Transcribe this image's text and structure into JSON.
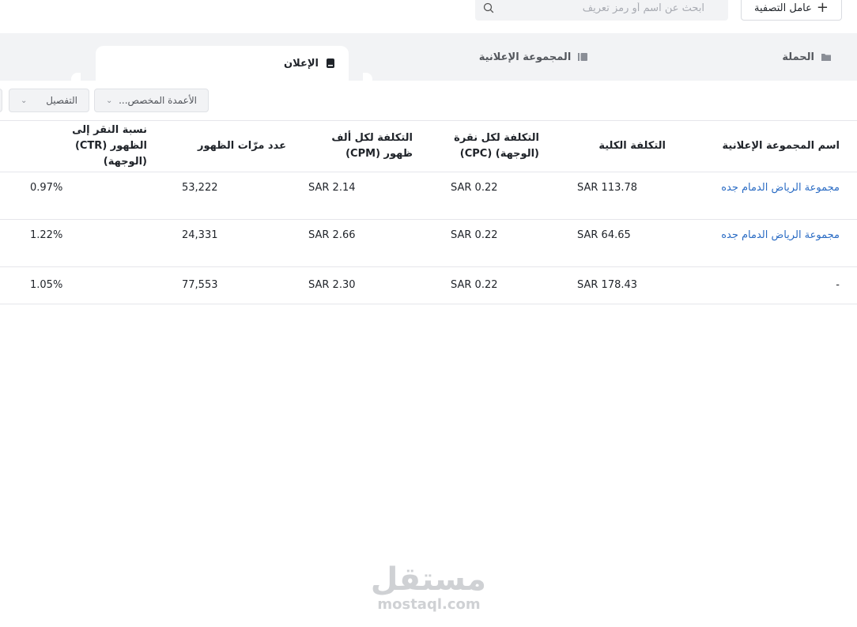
{
  "toolbar": {
    "filter_label": "عامل التصفية",
    "search_placeholder": "ابحث عن اسم أو رمز تعريف"
  },
  "tabs": [
    {
      "label": "الحملة",
      "icon": "folder-icon",
      "active": false
    },
    {
      "label": "المجموعة الإعلانية",
      "icon": "stack-icon",
      "active": false
    },
    {
      "label": "الإعلان",
      "icon": "ad-icon",
      "active": true
    }
  ],
  "controls": {
    "custom_columns_label": "الأعمدة المخصص...",
    "breakdown_label": "التفصيل"
  },
  "table": {
    "headers": [
      "اسم المجموعة الإعلانية",
      "التكلفة الكلية",
      "التكلفة لكل نقرة (الوجهة) (CPC)",
      "التكلفة لكل ألف ظهور (CPM)",
      "عدد مرّات الظهور",
      "نسبة النقر إلى الظهور (CTR) (الوجهة)"
    ],
    "rows": [
      {
        "name": "مجموعة الرياض الدمام جده",
        "total_cost": "SAR 113.78",
        "cpc": "SAR 0.22",
        "cpm": "SAR 2.14",
        "impressions": "53,222",
        "ctr": "0.97%"
      },
      {
        "name": "مجموعة الرياض الدمام جده",
        "total_cost": "SAR 64.65",
        "cpc": "SAR 0.22",
        "cpm": "SAR 2.66",
        "impressions": "24,331",
        "ctr": "1.22%"
      },
      {
        "name": "-",
        "total_cost": "SAR 178.43",
        "cpc": "SAR 0.22",
        "cpm": "SAR 2.30",
        "impressions": "77,553",
        "ctr": "1.05%"
      }
    ]
  },
  "watermark": {
    "arabic": "مستقل",
    "latin": "mostaql.com"
  },
  "colors": {
    "link": "#2b6cc4",
    "tab_bar_bg": "#f2f3f5",
    "border": "#e5e6eb"
  }
}
